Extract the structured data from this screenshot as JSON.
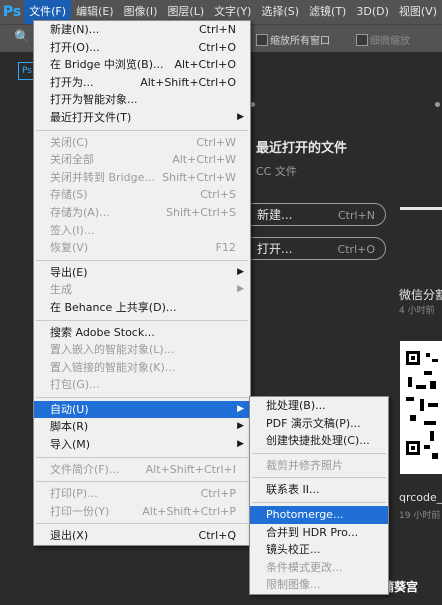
{
  "menubar": {
    "logo": "Ps",
    "items": [
      "文件(F)",
      "编辑(E)",
      "图像(I)",
      "图层(L)",
      "文字(Y)",
      "选择(S)",
      "滤镜(T)",
      "3D(D)",
      "视图(V)"
    ]
  },
  "options": {
    "zoom_all_label": "缩放所有窗口",
    "fine_zoom_label": "细微缩放"
  },
  "home": {
    "recent_title": "最近打开的文件",
    "cc_files": "CC 文件",
    "new_label": "新建...",
    "new_shortcut": "Ctrl+N",
    "open_label": "打开...",
    "open_shortcut": "Ctrl+O",
    "wechat_title": "微信分割",
    "wechat_time": "4 小时前",
    "qr_name": "qrcode_f",
    "qr_time": "19 小时前",
    "watermark": "鬼猎影的蒲葵宫"
  },
  "file_menu": [
    {
      "label": "新建(N)...",
      "shortcut": "Ctrl+N"
    },
    {
      "label": "打开(O)...",
      "shortcut": "Ctrl+O"
    },
    {
      "label": "在 Bridge 中浏览(B)...",
      "shortcut": "Alt+Ctrl+O"
    },
    {
      "label": "打开为...",
      "shortcut": "Alt+Shift+Ctrl+O"
    },
    {
      "label": "打开为智能对象..."
    },
    {
      "label": "最近打开文件(T)",
      "submenu": true
    },
    {
      "sep": true
    },
    {
      "label": "关闭(C)",
      "shortcut": "Ctrl+W",
      "disabled": true
    },
    {
      "label": "关闭全部",
      "shortcut": "Alt+Ctrl+W",
      "disabled": true
    },
    {
      "label": "关闭并转到 Bridge...",
      "shortcut": "Shift+Ctrl+W",
      "disabled": true
    },
    {
      "label": "存储(S)",
      "shortcut": "Ctrl+S",
      "disabled": true
    },
    {
      "label": "存储为(A)...",
      "shortcut": "Shift+Ctrl+S",
      "disabled": true
    },
    {
      "label": "签入(I)...",
      "disabled": true
    },
    {
      "label": "恢复(V)",
      "shortcut": "F12",
      "disabled": true
    },
    {
      "sep": true
    },
    {
      "label": "导出(E)",
      "submenu": true
    },
    {
      "label": "生成",
      "submenu": true,
      "disabled": true
    },
    {
      "label": "在 Behance 上共享(D)..."
    },
    {
      "sep": true
    },
    {
      "label": "搜索 Adobe Stock..."
    },
    {
      "label": "置入嵌入的智能对象(L)...",
      "disabled": true
    },
    {
      "label": "置入链接的智能对象(K)...",
      "disabled": true
    },
    {
      "label": "打包(G)...",
      "disabled": true
    },
    {
      "sep": true
    },
    {
      "label": "自动(U)",
      "submenu": true,
      "highlight": true
    },
    {
      "label": "脚本(R)",
      "submenu": true
    },
    {
      "label": "导入(M)",
      "submenu": true
    },
    {
      "sep": true
    },
    {
      "label": "文件简介(F)...",
      "shortcut": "Alt+Shift+Ctrl+I",
      "disabled": true
    },
    {
      "sep": true
    },
    {
      "label": "打印(P)...",
      "shortcut": "Ctrl+P",
      "disabled": true
    },
    {
      "label": "打印一份(Y)",
      "shortcut": "Alt+Shift+Ctrl+P",
      "disabled": true
    },
    {
      "sep": true
    },
    {
      "label": "退出(X)",
      "shortcut": "Ctrl+Q"
    }
  ],
  "auto_menu": [
    {
      "label": "批处理(B)..."
    },
    {
      "label": "PDF 演示文稿(P)..."
    },
    {
      "label": "创建快捷批处理(C)..."
    },
    {
      "sep": true
    },
    {
      "label": "裁剪并修齐照片",
      "disabled": true
    },
    {
      "sep": true
    },
    {
      "label": "联系表 II..."
    },
    {
      "sep": true
    },
    {
      "label": "Photomerge...",
      "highlight": true
    },
    {
      "label": "合并到 HDR Pro..."
    },
    {
      "label": "镜头校正..."
    },
    {
      "label": "条件模式更改...",
      "disabled": true
    },
    {
      "label": "限制图像...",
      "disabled": true
    }
  ]
}
